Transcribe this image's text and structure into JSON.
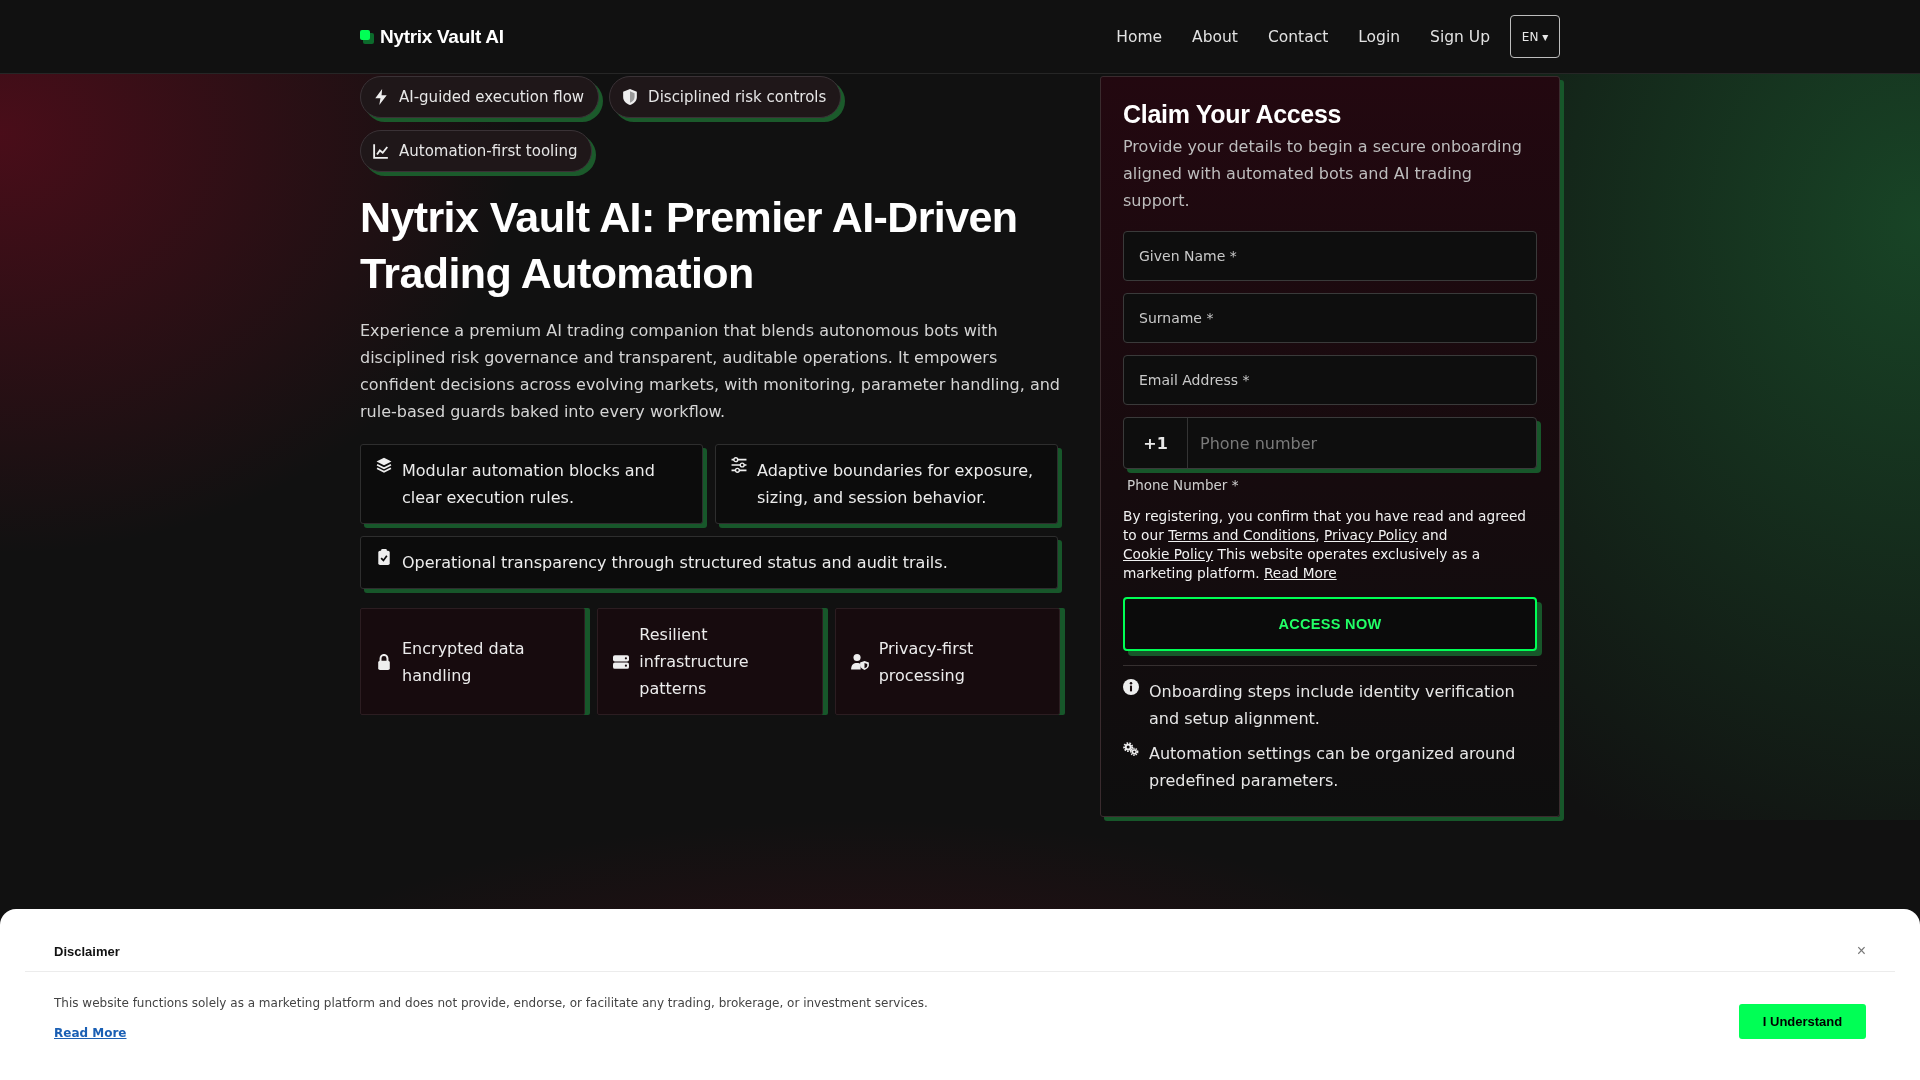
{
  "header": {
    "logo": "Nytrix Vault AI",
    "nav": [
      "Home",
      "About",
      "Contact",
      "Login",
      "Sign Up"
    ],
    "language": "EN ▾"
  },
  "hero": {
    "tags": [
      "AI-guided execution flow",
      "Disciplined risk controls",
      "Automation-first tooling"
    ],
    "title": "Nytrix Vault AI: Premier AI-Driven Trading Automation",
    "intro": "Experience a premium AI trading companion that blends autonomous bots with disciplined risk governance and transparent, auditable operations. It empowers confident decisions across evolving markets, with monitoring, parameter handling, and rule-based guards baked into every workflow.",
    "features": [
      "Modular automation blocks and clear execution rules.",
      "Adaptive boundaries for exposure, sizing, and session behavior.",
      "Operational transparency through structured status and audit trails."
    ],
    "assurances": [
      "Encrypted data handling",
      "Resilient infrastructure patterns",
      "Privacy-first processing"
    ]
  },
  "signup": {
    "title": "Claim Your Access",
    "description": "Provide your details to begin a secure onboarding aligned with automated bots and AI trading support.",
    "fields": [
      {
        "placeholder": "Given Name *"
      },
      {
        "placeholder": "Surname *"
      },
      {
        "placeholder": "Email Address *"
      }
    ],
    "phone": {
      "prefix": "+1",
      "placeholder": "Phone number",
      "label": "Phone Number *"
    },
    "legal": [
      {
        "kind": "text",
        "text": "By registering, you confirm that you have read and agreed to our "
      },
      {
        "kind": "link",
        "text": "Terms and Conditions"
      },
      {
        "kind": "text",
        "text": ", "
      },
      {
        "kind": "link",
        "text": "Privacy Policy"
      },
      {
        "kind": "text",
        "text": " and "
      },
      {
        "kind": "link",
        "text": "Cookie Policy"
      },
      {
        "kind": "text",
        "text": " This website operates exclusively as a marketing platform. "
      },
      {
        "kind": "link",
        "text": "Read More"
      }
    ],
    "submit": "ACCESS NOW",
    "notes": [
      "Onboarding steps include identity verification and setup alignment.",
      "Automation settings can be organized around predefined parameters."
    ]
  },
  "disclaimer": {
    "title": "Disclaimer",
    "close": "×",
    "text": "This website functions solely as a marketing platform and does not provide, endorse, or facilitate any trading, brokerage, or investment services.",
    "link": "Read More",
    "button": "I Understand"
  }
}
